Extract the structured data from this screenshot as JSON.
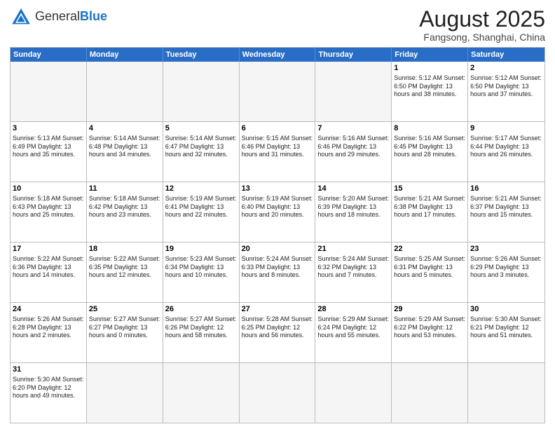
{
  "header": {
    "logo_general": "General",
    "logo_blue": "Blue",
    "title": "August 2025",
    "subtitle": "Fangsong, Shanghai, China"
  },
  "weekdays": [
    "Sunday",
    "Monday",
    "Tuesday",
    "Wednesday",
    "Thursday",
    "Friday",
    "Saturday"
  ],
  "rows": [
    [
      {
        "day": "",
        "info": "",
        "empty": true
      },
      {
        "day": "",
        "info": "",
        "empty": true
      },
      {
        "day": "",
        "info": "",
        "empty": true
      },
      {
        "day": "",
        "info": "",
        "empty": true
      },
      {
        "day": "",
        "info": "",
        "empty": true
      },
      {
        "day": "1",
        "info": "Sunrise: 5:12 AM\nSunset: 6:50 PM\nDaylight: 13 hours\nand 38 minutes."
      },
      {
        "day": "2",
        "info": "Sunrise: 5:12 AM\nSunset: 6:50 PM\nDaylight: 13 hours\nand 37 minutes."
      }
    ],
    [
      {
        "day": "3",
        "info": "Sunrise: 5:13 AM\nSunset: 6:49 PM\nDaylight: 13 hours\nand 35 minutes."
      },
      {
        "day": "4",
        "info": "Sunrise: 5:14 AM\nSunset: 6:48 PM\nDaylight: 13 hours\nand 34 minutes."
      },
      {
        "day": "5",
        "info": "Sunrise: 5:14 AM\nSunset: 6:47 PM\nDaylight: 13 hours\nand 32 minutes."
      },
      {
        "day": "6",
        "info": "Sunrise: 5:15 AM\nSunset: 6:46 PM\nDaylight: 13 hours\nand 31 minutes."
      },
      {
        "day": "7",
        "info": "Sunrise: 5:16 AM\nSunset: 6:46 PM\nDaylight: 13 hours\nand 29 minutes."
      },
      {
        "day": "8",
        "info": "Sunrise: 5:16 AM\nSunset: 6:45 PM\nDaylight: 13 hours\nand 28 minutes."
      },
      {
        "day": "9",
        "info": "Sunrise: 5:17 AM\nSunset: 6:44 PM\nDaylight: 13 hours\nand 26 minutes."
      }
    ],
    [
      {
        "day": "10",
        "info": "Sunrise: 5:18 AM\nSunset: 6:43 PM\nDaylight: 13 hours\nand 25 minutes."
      },
      {
        "day": "11",
        "info": "Sunrise: 5:18 AM\nSunset: 6:42 PM\nDaylight: 13 hours\nand 23 minutes."
      },
      {
        "day": "12",
        "info": "Sunrise: 5:19 AM\nSunset: 6:41 PM\nDaylight: 13 hours\nand 22 minutes."
      },
      {
        "day": "13",
        "info": "Sunrise: 5:19 AM\nSunset: 6:40 PM\nDaylight: 13 hours\nand 20 minutes."
      },
      {
        "day": "14",
        "info": "Sunrise: 5:20 AM\nSunset: 6:39 PM\nDaylight: 13 hours\nand 18 minutes."
      },
      {
        "day": "15",
        "info": "Sunrise: 5:21 AM\nSunset: 6:38 PM\nDaylight: 13 hours\nand 17 minutes."
      },
      {
        "day": "16",
        "info": "Sunrise: 5:21 AM\nSunset: 6:37 PM\nDaylight: 13 hours\nand 15 minutes."
      }
    ],
    [
      {
        "day": "17",
        "info": "Sunrise: 5:22 AM\nSunset: 6:36 PM\nDaylight: 13 hours\nand 14 minutes."
      },
      {
        "day": "18",
        "info": "Sunrise: 5:22 AM\nSunset: 6:35 PM\nDaylight: 13 hours\nand 12 minutes."
      },
      {
        "day": "19",
        "info": "Sunrise: 5:23 AM\nSunset: 6:34 PM\nDaylight: 13 hours\nand 10 minutes."
      },
      {
        "day": "20",
        "info": "Sunrise: 5:24 AM\nSunset: 6:33 PM\nDaylight: 13 hours\nand 8 minutes."
      },
      {
        "day": "21",
        "info": "Sunrise: 5:24 AM\nSunset: 6:32 PM\nDaylight: 13 hours\nand 7 minutes."
      },
      {
        "day": "22",
        "info": "Sunrise: 5:25 AM\nSunset: 6:31 PM\nDaylight: 13 hours\nand 5 minutes."
      },
      {
        "day": "23",
        "info": "Sunrise: 5:26 AM\nSunset: 6:29 PM\nDaylight: 13 hours\nand 3 minutes."
      }
    ],
    [
      {
        "day": "24",
        "info": "Sunrise: 5:26 AM\nSunset: 6:28 PM\nDaylight: 13 hours\nand 2 minutes."
      },
      {
        "day": "25",
        "info": "Sunrise: 5:27 AM\nSunset: 6:27 PM\nDaylight: 13 hours\nand 0 minutes."
      },
      {
        "day": "26",
        "info": "Sunrise: 5:27 AM\nSunset: 6:26 PM\nDaylight: 12 hours\nand 58 minutes."
      },
      {
        "day": "27",
        "info": "Sunrise: 5:28 AM\nSunset: 6:25 PM\nDaylight: 12 hours\nand 56 minutes."
      },
      {
        "day": "28",
        "info": "Sunrise: 5:29 AM\nSunset: 6:24 PM\nDaylight: 12 hours\nand 55 minutes."
      },
      {
        "day": "29",
        "info": "Sunrise: 5:29 AM\nSunset: 6:22 PM\nDaylight: 12 hours\nand 53 minutes."
      },
      {
        "day": "30",
        "info": "Sunrise: 5:30 AM\nSunset: 6:21 PM\nDaylight: 12 hours\nand 51 minutes."
      }
    ],
    [
      {
        "day": "31",
        "info": "Sunrise: 5:30 AM\nSunset: 6:20 PM\nDaylight: 12 hours\nand 49 minutes."
      },
      {
        "day": "",
        "info": "",
        "empty": true
      },
      {
        "day": "",
        "info": "",
        "empty": true
      },
      {
        "day": "",
        "info": "",
        "empty": true
      },
      {
        "day": "",
        "info": "",
        "empty": true
      },
      {
        "day": "",
        "info": "",
        "empty": true
      },
      {
        "day": "",
        "info": "",
        "empty": true
      }
    ]
  ]
}
